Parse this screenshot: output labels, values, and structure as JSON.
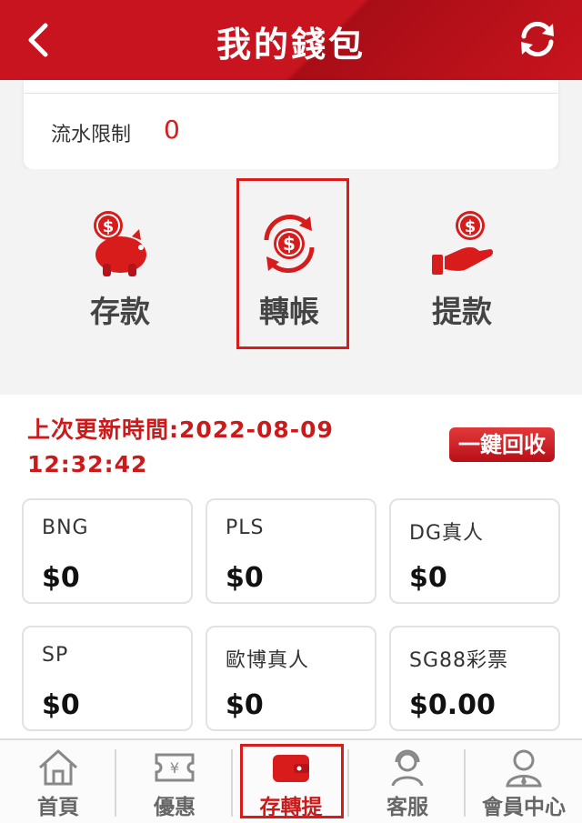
{
  "header": {
    "title": "我的錢包",
    "back_icon": "chevron-left-icon",
    "refresh_icon": "refresh-icon"
  },
  "wallet": {
    "rollover_label": "流水限制",
    "rollover_value": "0"
  },
  "actions": [
    {
      "label": "存款",
      "icon": "piggy-bank-icon"
    },
    {
      "label": "轉帳",
      "icon": "transfer-cycle-icon"
    },
    {
      "label": "提款",
      "icon": "hand-coin-icon"
    }
  ],
  "update": {
    "label": "上次更新時間:2022-08-09 12:32:42",
    "recycle_label": "一鍵回收"
  },
  "games": [
    {
      "name": "BNG",
      "balance": "$0"
    },
    {
      "name": "PLS",
      "balance": "$0"
    },
    {
      "name": "DG真人",
      "balance": "$0"
    },
    {
      "name": "SP",
      "balance": "$0"
    },
    {
      "name": "歐博真人",
      "balance": "$0"
    },
    {
      "name": "SG88彩票",
      "balance": "$0.00"
    }
  ],
  "tabs": [
    {
      "label": "首頁",
      "icon": "home-icon"
    },
    {
      "label": "優惠",
      "icon": "ticket-icon"
    },
    {
      "label": "存轉提",
      "icon": "wallet-icon",
      "active": true
    },
    {
      "label": "客服",
      "icon": "headset-icon"
    },
    {
      "label": "會員中心",
      "icon": "user-icon"
    }
  ],
  "colors": {
    "brand_red": "#c8141e",
    "accent_red": "#d61c1c"
  }
}
